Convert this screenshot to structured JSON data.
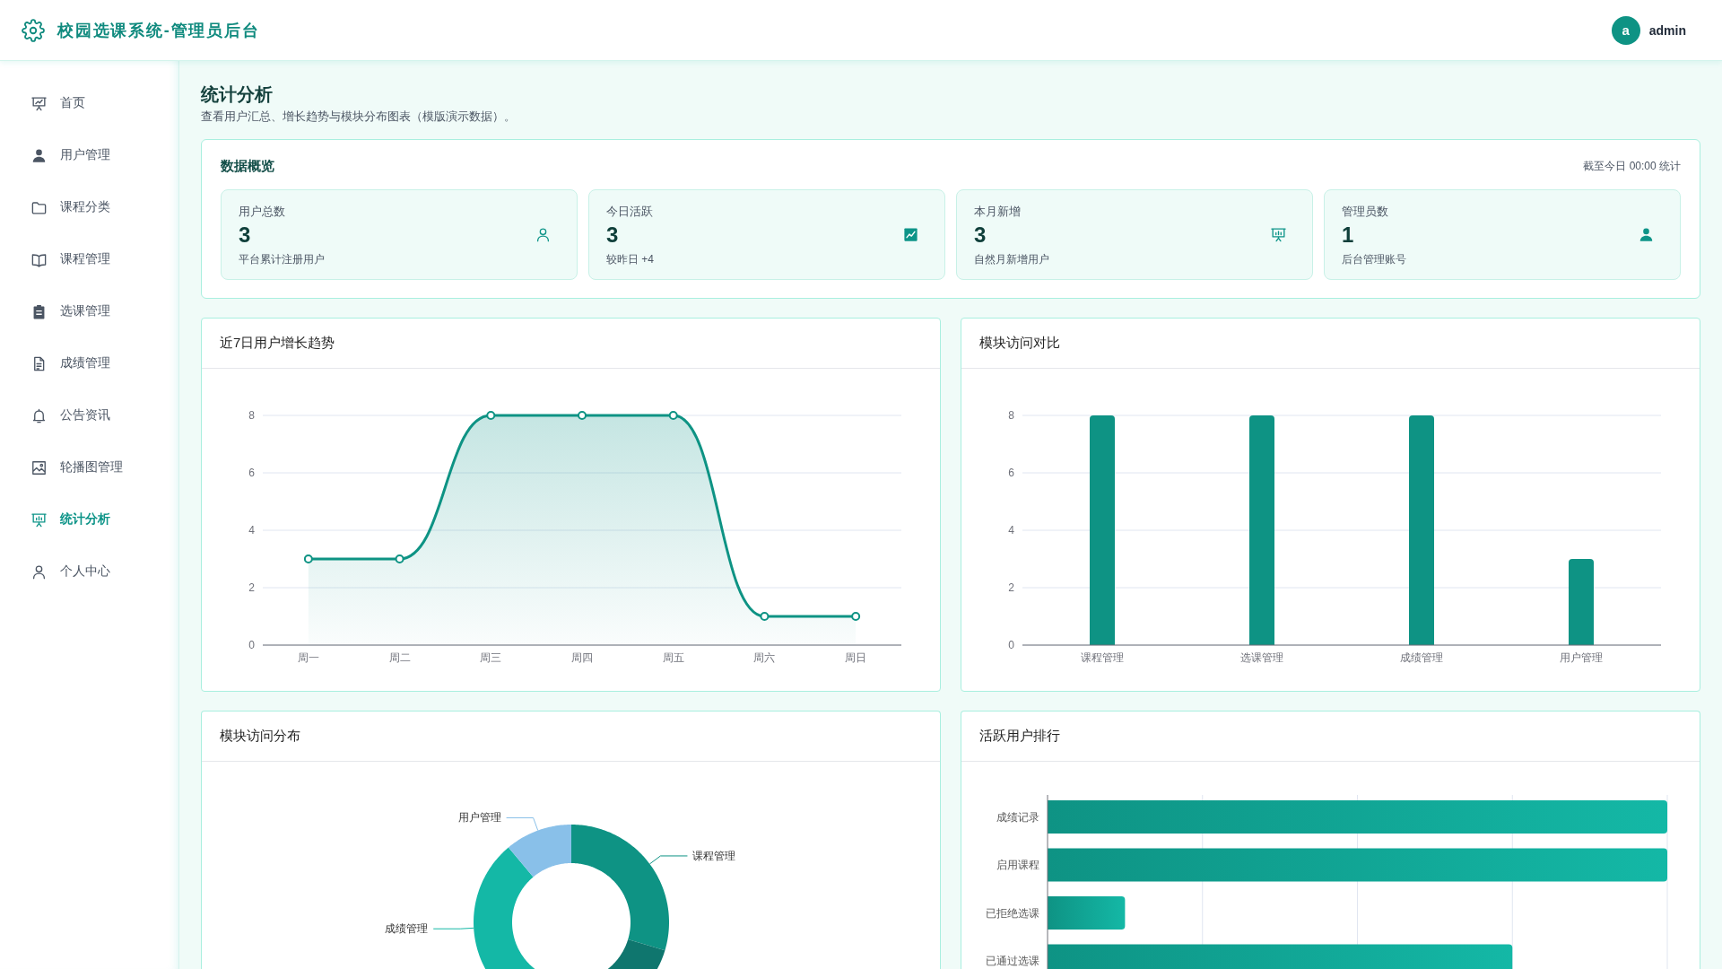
{
  "header": {
    "title": "校园选课系统-管理员后台",
    "user": {
      "avatar": "a",
      "name": "admin"
    }
  },
  "sidebar": {
    "items": [
      {
        "label": "首页",
        "selected": false
      },
      {
        "label": "用户管理",
        "selected": false
      },
      {
        "label": "课程分类",
        "selected": false
      },
      {
        "label": "课程管理",
        "selected": false
      },
      {
        "label": "选课管理",
        "selected": false
      },
      {
        "label": "成绩管理",
        "selected": false
      },
      {
        "label": "公告资讯",
        "selected": false
      },
      {
        "label": "轮播图管理",
        "selected": false
      },
      {
        "label": "统计分析",
        "selected": true
      },
      {
        "label": "个人中心",
        "selected": false
      }
    ]
  },
  "page": {
    "title": "统计分析",
    "subtitle": "查看用户汇总、增长趋势与模块分布图表（模版演示数据）。"
  },
  "overview": {
    "title": "数据概览",
    "note": "截至今日 00:00 统计",
    "stats": [
      {
        "label": "用户总数",
        "value": "3",
        "caption": "平台累计注册用户"
      },
      {
        "label": "今日活跃",
        "value": "3",
        "caption": "较昨日 +4"
      },
      {
        "label": "本月新增",
        "value": "3",
        "caption": "自然月新增用户"
      },
      {
        "label": "管理员数",
        "value": "1",
        "caption": "后台管理账号"
      }
    ]
  },
  "growth_trend": {
    "title": "近7日用户增长趋势",
    "chart_data": {
      "type": "area",
      "categories": [
        "周一",
        "周二",
        "周三",
        "周四",
        "周五",
        "周六",
        "周日"
      ],
      "values": [
        3,
        3,
        8,
        8,
        8,
        1,
        1
      ],
      "ylim": [
        0,
        8
      ],
      "yticks": [
        0,
        2,
        4,
        6,
        8
      ],
      "grid": true
    }
  },
  "module_visits": {
    "title": "模块访问对比",
    "chart_data": {
      "type": "bar",
      "categories": [
        "课程管理",
        "选课管理",
        "成绩管理",
        "用户管理"
      ],
      "values": [
        8,
        8,
        8,
        3
      ],
      "ylim": [
        0,
        8
      ],
      "yticks": [
        0,
        2,
        4,
        6,
        8
      ],
      "grid": true
    }
  },
  "module_distribution": {
    "title": "模块访问分布",
    "chart_data": {
      "type": "donut",
      "categories": [
        "课程管理",
        null,
        "成绩管理",
        "用户管理"
      ],
      "values": [
        29.63,
        29.63,
        29.63,
        11.11
      ]
    }
  },
  "active_users": {
    "title": "活跃用户排行",
    "categories": [
      "成绩记录",
      "启用课程",
      "已拒绝选课",
      "已通过选课"
    ]
  }
}
